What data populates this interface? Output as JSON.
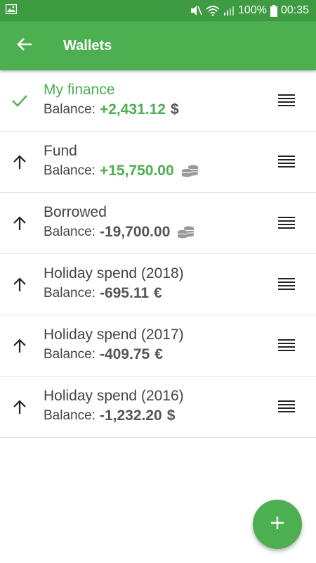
{
  "status_bar": {
    "battery": "100%",
    "time": "00:35",
    "icons": [
      "image-icon",
      "mute-icon",
      "wifi-icon",
      "signal-icon",
      "battery-icon"
    ]
  },
  "app_bar": {
    "title": "Wallets",
    "back_icon": "arrow-left-icon"
  },
  "colors": {
    "primary": "#4caf50",
    "status_bar": "#3e9b41",
    "positive": "#4caf50",
    "text": "#444444"
  },
  "wallets": [
    {
      "name": "My finance",
      "balance_label": "Balance:",
      "balance": "+2,431.12",
      "currency": "$",
      "icon": "check-icon",
      "active": true
    },
    {
      "name": "Fund",
      "balance_label": "Balance:",
      "balance": "+15,750.00",
      "currency": "",
      "icon": "arrow-up-icon",
      "coins": true
    },
    {
      "name": "Borrowed",
      "balance_label": "Balance:",
      "balance": "-19,700.00",
      "currency": "",
      "icon": "arrow-up-icon",
      "coins": true
    },
    {
      "name": "Holiday spend (2018)",
      "balance_label": "Balance:",
      "balance": "-695.11",
      "currency": "€",
      "icon": "arrow-up-icon"
    },
    {
      "name": "Holiday spend (2017)",
      "balance_label": "Balance:",
      "balance": "-409.75",
      "currency": "€",
      "icon": "arrow-up-icon"
    },
    {
      "name": "Holiday spend (2016)",
      "balance_label": "Balance:",
      "balance": "-1,232.20",
      "currency": "$",
      "icon": "arrow-up-icon"
    }
  ],
  "fab": {
    "icon": "plus-icon"
  }
}
